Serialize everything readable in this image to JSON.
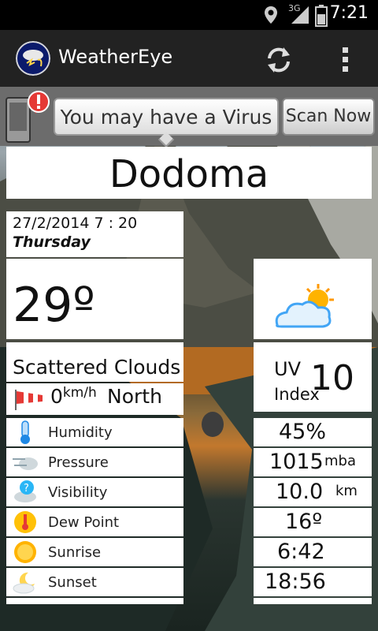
{
  "status_bar": {
    "time": "7:21",
    "network": "3G"
  },
  "app": {
    "title": "WeatherEye",
    "colors": {
      "action_bar": "#222222",
      "status_bar": "#000000",
      "panel": "#ffffff"
    }
  },
  "ad": {
    "message": "You may have a Virus",
    "button": "Scan Now"
  },
  "city": "Dodoma",
  "datetime": {
    "date": "27/2/2014 7 : 20",
    "day": "Thursday"
  },
  "current": {
    "temperature": "29º",
    "condition": "Scattered Clouds",
    "icon": "partly-cloudy-icon"
  },
  "wind": {
    "speed": "0",
    "unit": "km/h",
    "direction": "North"
  },
  "uv": {
    "label1": "UV",
    "label2": "Index",
    "value": "10"
  },
  "details": [
    {
      "label": "Humidity",
      "value": "45%",
      "unit": "",
      "icon": "thermometer-icon"
    },
    {
      "label": "Pressure",
      "value": "1015",
      "unit": "mba",
      "icon": "wind-cloud-icon"
    },
    {
      "label": "Visibility",
      "value": "10.0",
      "unit": "km",
      "icon": "question-cloud-icon"
    },
    {
      "label": "Dew Point",
      "value": "16º",
      "unit": "",
      "icon": "sun-thermometer-icon"
    },
    {
      "label": "Sunrise",
      "value": "6:42",
      "unit": "",
      "icon": "sun-icon"
    },
    {
      "label": "Sunset",
      "value": "18:56",
      "unit": "",
      "icon": "moon-cloud-icon"
    }
  ]
}
